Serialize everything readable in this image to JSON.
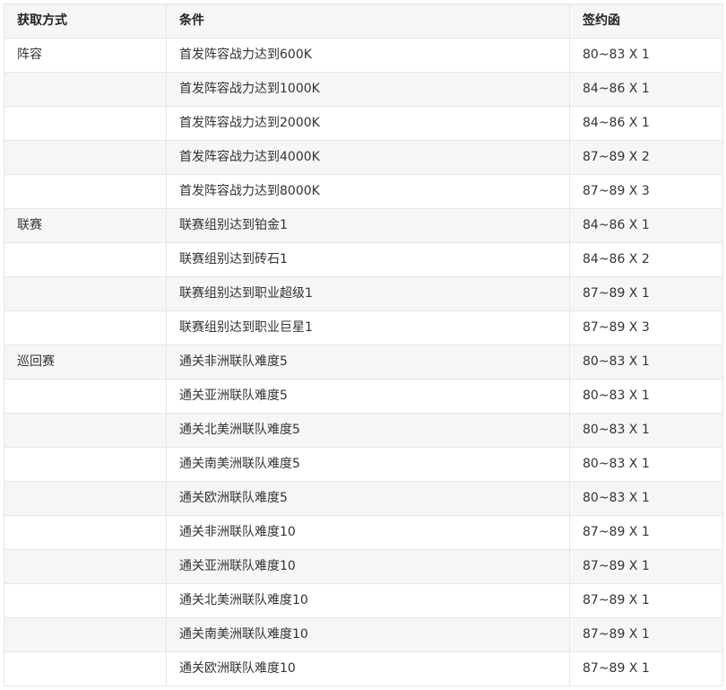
{
  "table": {
    "headers": [
      "获取方式",
      "条件",
      "签约函"
    ],
    "rows": [
      [
        "阵容",
        "首发阵容战力达到600K",
        "80~83 X 1"
      ],
      [
        "",
        "首发阵容战力达到1000K",
        "84~86 X 1"
      ],
      [
        "",
        "首发阵容战力达到2000K",
        "84~86 X 1"
      ],
      [
        "",
        "首发阵容战力达到4000K",
        "87~89 X 2"
      ],
      [
        "",
        "首发阵容战力达到8000K",
        "87~89 X 3"
      ],
      [
        "联赛",
        "联赛组别达到铂金1",
        "84~86 X 1"
      ],
      [
        "",
        "联赛组别达到砖石1",
        "84~86 X 2"
      ],
      [
        "",
        "联赛组别达到职业超级1",
        "87~89 X 1"
      ],
      [
        "",
        "联赛组别达到职业巨星1",
        "87~89 X 3"
      ],
      [
        "巡回赛",
        "通关非洲联队难度5",
        "80~83 X 1"
      ],
      [
        "",
        "通关亚洲联队难度5",
        "80~83 X 1"
      ],
      [
        "",
        "通关北美洲联队难度5",
        "80~83 X 1"
      ],
      [
        "",
        "通关南美洲联队难度5",
        "80~83 X 1"
      ],
      [
        "",
        "通关欧洲联队难度5",
        "80~83 X 1"
      ],
      [
        "",
        "通关非洲联队难度10",
        "87~89 X 1"
      ],
      [
        "",
        "通关亚洲联队难度10",
        "87~89 X 1"
      ],
      [
        "",
        "通关北美洲联队难度10",
        "87~89 X 1"
      ],
      [
        "",
        "通关南美洲联队难度10",
        "87~89 X 1"
      ],
      [
        "",
        "通关欧洲联队难度10",
        "87~89 X 1"
      ]
    ]
  }
}
